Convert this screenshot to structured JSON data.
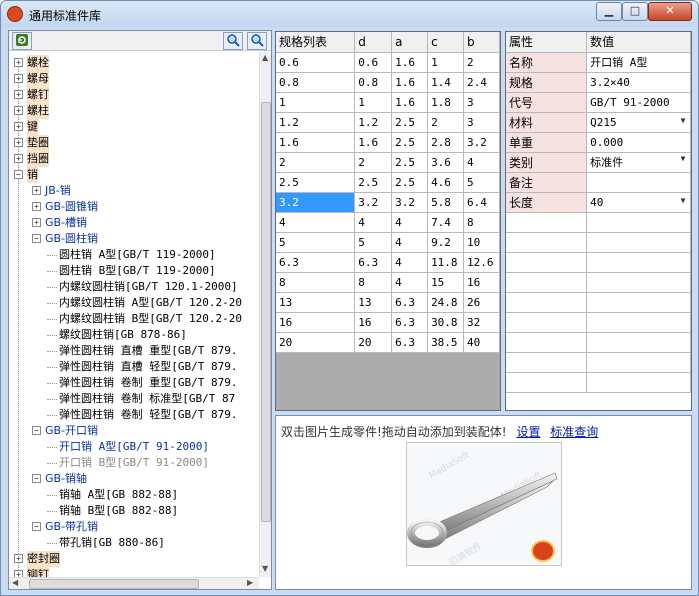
{
  "window": {
    "title": "通用标准件库",
    "min": "▁",
    "max": "□",
    "close": "✕"
  },
  "toolbar": {
    "refresh_icon": "refresh-icon",
    "search_icon_1": "search-icon",
    "search_icon_2": "zoom-icon"
  },
  "tree": {
    "top_items": [
      "螺栓",
      "螺母",
      "螺钉",
      "螺柱",
      "键",
      "垫圈",
      "挡圈",
      "销"
    ],
    "pin_children": [
      "JB-销",
      "GB-圆锥销",
      "GB-槽销",
      "GB-圆柱销"
    ],
    "cylinder_pins": [
      "圆柱销 A型[GB/T 119-2000]",
      "圆柱销 B型[GB/T 119-2000]",
      "内螺纹圆柱销[GB/T 120.1-2000]",
      "内螺纹圆柱销 A型[GB/T 120.2-20",
      "内螺纹圆柱销 B型[GB/T 120.2-20",
      "螺纹圆柱销[GB 878-86]",
      "弹性圆柱销 直槽 重型[GB/T 879.",
      "弹性圆柱销 直槽 轻型[GB/T 879.",
      "弹性圆柱销 卷制 重型[GB/T 879.",
      "弹性圆柱销 卷制 标准型[GB/T 87",
      "弹性圆柱销 卷制 轻型[GB/T 879."
    ],
    "split_pin_group": "GB-开口销",
    "split_pins": [
      "开口销 A型[GB/T 91-2000]",
      "开口销 B型[GB/T 91-2000]"
    ],
    "shaft_pin_group": "GB-销轴",
    "shaft_pins": [
      "销轴 A型[GB 882-88]",
      "销轴 B型[GB 882-88]"
    ],
    "hole_pin_group": "GB-带孔销",
    "hole_pins": [
      "带孔销[GB 880-86]"
    ],
    "bottom_items": [
      "密封圈",
      "铆钉"
    ]
  },
  "spec_table": {
    "headers": [
      "规格列表",
      "d",
      "a",
      "c",
      "b"
    ],
    "rows": [
      [
        "0.6",
        "0.6",
        "1.6",
        "1",
        "2"
      ],
      [
        "0.8",
        "0.8",
        "1.6",
        "1.4",
        "2.4"
      ],
      [
        "1",
        "1",
        "1.6",
        "1.8",
        "3"
      ],
      [
        "1.2",
        "1.2",
        "2.5",
        "2",
        "3"
      ],
      [
        "1.6",
        "1.6",
        "2.5",
        "2.8",
        "3.2"
      ],
      [
        "2",
        "2",
        "2.5",
        "3.6",
        "4"
      ],
      [
        "2.5",
        "2.5",
        "2.5",
        "4.6",
        "5"
      ],
      [
        "3.2",
        "3.2",
        "3.2",
        "5.8",
        "6.4"
      ],
      [
        "4",
        "4",
        "4",
        "7.4",
        "8"
      ],
      [
        "5",
        "5",
        "4",
        "9.2",
        "10"
      ],
      [
        "6.3",
        "6.3",
        "4",
        "11.8",
        "12.6"
      ],
      [
        "8",
        "8",
        "4",
        "15",
        "16"
      ],
      [
        "13",
        "13",
        "6.3",
        "24.8",
        "26"
      ],
      [
        "16",
        "16",
        "6.3",
        "30.8",
        "32"
      ],
      [
        "20",
        "20",
        "6.3",
        "38.5",
        "40"
      ]
    ],
    "selected_row": 7
  },
  "props": {
    "headers": [
      "属性",
      "数值"
    ],
    "rows": [
      {
        "k": "名称",
        "v": "开口销 A型",
        "dd": false
      },
      {
        "k": "规格",
        "v": "3.2×40",
        "dd": false
      },
      {
        "k": "代号",
        "v": "GB/T 91-2000",
        "dd": false
      },
      {
        "k": "材料",
        "v": "Q215",
        "dd": true
      },
      {
        "k": "单重",
        "v": "0.000",
        "dd": false
      },
      {
        "k": "类别",
        "v": "标准件",
        "dd": true
      },
      {
        "k": "备注",
        "v": "",
        "dd": false
      },
      {
        "k": "长度",
        "v": "40",
        "dd": true
      }
    ]
  },
  "preview": {
    "hint": "双击图片生成零件!拖动自动添加到装配体!",
    "link_settings": "设置",
    "link_query": "标准查询",
    "watermark_1": "MediaSoft",
    "watermark_2": "迈迪软件"
  }
}
